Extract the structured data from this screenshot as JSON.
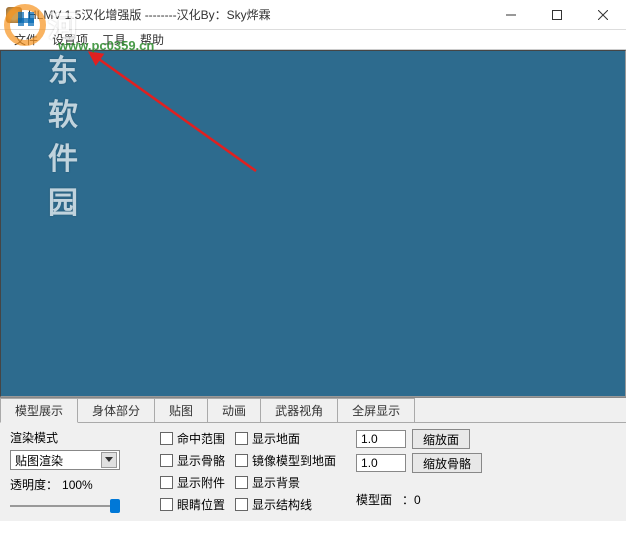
{
  "titlebar": {
    "title": "HLMV 1.5汉化增强版 --------汉化By：Sky烨霖"
  },
  "menu": {
    "file": "文件",
    "options": "设置项",
    "tools": "工具",
    "help": "帮助"
  },
  "watermark": {
    "text": "河东软件园",
    "url": "www.pc0359.cn"
  },
  "tabs": {
    "model_display": "模型展示",
    "body_parts": "身体部分",
    "texture": "贴图",
    "animation": "动画",
    "weapon_view": "武器视角",
    "fullscreen": "全屏显示"
  },
  "panel": {
    "render_mode_label": "渲染模式",
    "render_mode_value": "贴图渲染",
    "opacity_label": "透明度：",
    "opacity_value": "100%",
    "checks": {
      "hit_range": "命中范围",
      "show_skeleton": "显示骨骼",
      "show_attach": "显示附件",
      "eye_pos": "眼睛位置",
      "show_ground": "显示地面",
      "mirror_ground": "镜像模型到地面",
      "show_bg": "显示背景",
      "show_wireframe": "显示结构线"
    },
    "scale_face_value": "1.0",
    "scale_face_btn": "缩放面",
    "scale_bone_value": "1.0",
    "scale_bone_btn": "缩放骨骼",
    "model_face_label": "模型面",
    "model_face_value": "：0"
  }
}
